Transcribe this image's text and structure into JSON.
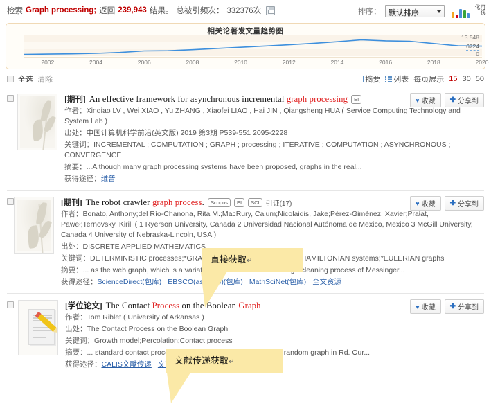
{
  "header": {
    "search_label": "检索",
    "query": "Graph processing;",
    "returned_label": "返回",
    "result_count": "239,943",
    "result_suffix": "结果。",
    "cited_label": "总被引频次：",
    "cited_count": "332376次",
    "save_icon": "save-icon",
    "sort_label": "排序：",
    "sort_value": "默认排序",
    "visual_label": "可视化"
  },
  "chart_data": {
    "type": "line",
    "title": "相关论著发文量趋势图",
    "xlabel": "",
    "ylabel": "",
    "ylim": [
      0,
      13548
    ],
    "yticks": [
      "13 548",
      "6724",
      "0"
    ],
    "grid": true,
    "legend": "none",
    "line_color": "#3d8fdd",
    "categories": [
      2001,
      2002,
      2003,
      2004,
      2005,
      2006,
      2007,
      2008,
      2009,
      2010,
      2011,
      2012,
      2013,
      2014,
      2015,
      2016,
      2017,
      2018,
      2019,
      2020
    ],
    "tick_labels": [
      "2002",
      "2004",
      "2006",
      "2008",
      "2010",
      "2012",
      "2014",
      "2016",
      "2018",
      "2020"
    ],
    "values": [
      1100,
      1300,
      1500,
      1800,
      2400,
      3400,
      3500,
      4200,
      5000,
      5800,
      6600,
      7400,
      8300,
      9400,
      10600,
      10000,
      9700,
      8200,
      6724,
      6500
    ]
  },
  "listbar": {
    "select_all": "全选",
    "clear": "清除",
    "abstract_view": "摘要",
    "list_view": "列表",
    "per_page_label": "每页展示",
    "per_page_options": [
      "15",
      "30",
      "50"
    ],
    "per_page_active": "15"
  },
  "labels": {
    "authors": "作者：",
    "source": "出处：",
    "keywords": "关键词：",
    "abstract": "摘要：",
    "access": "获得途径：",
    "fav": "收藏",
    "share": "分享到",
    "heart_icon": "heart-icon",
    "plus_icon": "plus-icon"
  },
  "results": [
    {
      "type": "[期刊]",
      "title_plain_1": "An effective framework for asynchronous incremental ",
      "title_hl": "graph processing",
      "badges": [
        "EI"
      ],
      "cite": "",
      "authors": "Xinqiao LV , Wei XIAO , Yu ZHANG , Xiaofei LIAO , Hai JIN , Qiangsheng HUA ( Service Computing Technology and System Lab )",
      "source": "中国计算机科学前沿(英文版) 2019 第3期 P539-551  2095-2228",
      "keywords": "INCREMENTAL ; COMPUTATION ; GRAPH ; processing ; ITERATIVE ; COMPUTATION ; ASYNCHRONOUS ; CONVERGENCE",
      "abstract": "...Although many graph processing systems have been proposed, graphs in the real...",
      "access_links": [
        "维普"
      ],
      "thumb": "leaf-thumbnail"
    },
    {
      "type": "[期刊]",
      "title_plain_1": "The robot crawler ",
      "title_hl": "graph process",
      "title_plain_2": ".",
      "badges": [
        "Scopus",
        "EI",
        "SCI"
      ],
      "cite": "引证(17)",
      "authors": "Bonato, Anthony;del Río-Chanona, Rita M.;MacRury, Calum;Nicolaidis, Jake;Pérez-Giménez, Xavier;Prałat, Paweł;Ternovsky, Kirill ( 1 Ryerson University, Canada 2 Universidad Nacional Autónoma de Mexico, Mexico 3 McGill University, Canada 4 University of Nebraska-Lincoln, USA )",
      "source": "DISCRETE APPLIED MATHEMATICS",
      "keywords": "DETERMINISTIC processes;*GRAPH theory;*RANDOM graphs;*HAMILTONIAN systems;*EULERIAN graphs",
      "abstract": "... as the web graph, which is a variation on the robot vacuum edge-cleaning process of Messinger...",
      "access_links": [
        "ScienceDirect(包库)",
        "EBSCO(asp/bsp)(包库)",
        "MathSciNet(包库)",
        "全文资源"
      ],
      "thumb": "leaf-thumbnail"
    },
    {
      "type": "[学位论文]",
      "title_plain_1": "The Contact ",
      "title_hl": "Process",
      "title_plain_2": " on the Boolean ",
      "title_hl2": "Graph",
      "badges": [],
      "cite": "",
      "authors": "Tom Riblet ( University of Arkansas )",
      "source": "The Contact Process on the Boolean Graph",
      "keywords": "Growth model;Percolation;Contact process",
      "abstract": "... standard contact process on the Boolean graph which is a random graph in Rd. Our...",
      "access_links": [
        "CALIS文献传递",
        "文献传递"
      ],
      "thumb": "document-pencil-thumbnail"
    }
  ],
  "callouts": [
    {
      "text": "直接获取",
      "mark": "↵"
    },
    {
      "text": "文献传递获取",
      "mark": "↵"
    }
  ]
}
